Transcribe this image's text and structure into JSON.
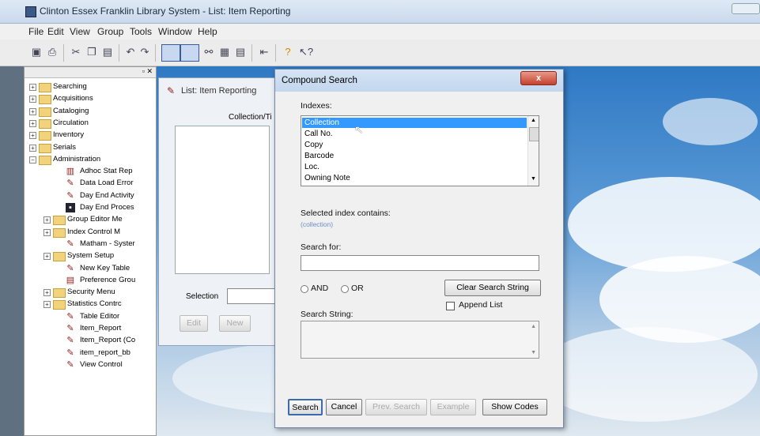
{
  "window": {
    "title": "Clinton Essex Franklin Library System - List: Item Reporting"
  },
  "menu": [
    "File",
    "Edit",
    "View",
    "Group",
    "Tools",
    "Window",
    "Help"
  ],
  "toolbar_icons": [
    "save-icon",
    "print-icon",
    "cut-icon",
    "copy-icon",
    "paste-icon",
    "undo-icon",
    "redo-icon",
    "window-icon",
    "split-window-icon",
    "link-icon",
    "grid-icon",
    "form-icon",
    "back-icon",
    "help-icon",
    "context-help-icon"
  ],
  "tree": {
    "items": [
      {
        "label": "Searching",
        "type": "folder",
        "expand": "+"
      },
      {
        "label": "Acquisitions",
        "type": "folder",
        "expand": "+"
      },
      {
        "label": "Cataloging",
        "type": "folder",
        "expand": "+"
      },
      {
        "label": "Circulation",
        "type": "folder",
        "expand": "+"
      },
      {
        "label": "Inventory",
        "type": "folder",
        "expand": "+"
      },
      {
        "label": "Serials",
        "type": "folder",
        "expand": "+"
      },
      {
        "label": "Administration",
        "type": "folder",
        "expand": "−"
      },
      {
        "label": "Adhoc Stat Rep",
        "type": "doc",
        "icon": "▥"
      },
      {
        "label": "Data Load Error",
        "type": "doc",
        "icon": "✎"
      },
      {
        "label": "Day End Activity",
        "type": "doc",
        "icon": "✎"
      },
      {
        "label": "Day End Proces",
        "type": "doc",
        "icon": "▪"
      },
      {
        "label": "Group Editor Me",
        "type": "folder",
        "expand": "+"
      },
      {
        "label": "Index Control M",
        "type": "folder",
        "expand": "+"
      },
      {
        "label": "Matham - Syster",
        "type": "doc",
        "icon": "✎"
      },
      {
        "label": "System Setup",
        "type": "folder",
        "expand": "+"
      },
      {
        "label": "New Key Table",
        "type": "doc",
        "icon": "✎"
      },
      {
        "label": "Preference Grou",
        "type": "doc",
        "icon": "▤"
      },
      {
        "label": "Security Menu",
        "type": "folder",
        "expand": "+"
      },
      {
        "label": "Statistics Contrc",
        "type": "folder",
        "expand": "+"
      },
      {
        "label": "Table Editor",
        "type": "doc",
        "icon": "✎"
      },
      {
        "label": "Item_Report",
        "type": "doc",
        "icon": "✎"
      },
      {
        "label": "Item_Report (Co",
        "type": "doc",
        "icon": "✎"
      },
      {
        "label": "item_report_bb",
        "type": "doc",
        "icon": "✎"
      },
      {
        "label": "View Control",
        "type": "doc",
        "icon": "✎"
      }
    ]
  },
  "list_window": {
    "title": "List: Item Reporting",
    "column_header": "Collection/Ti",
    "selection_label": "Selection",
    "edit_label": "Edit",
    "new_label": "New"
  },
  "dialog": {
    "title": "Compound Search",
    "close_label": "x",
    "indexes_label": "Indexes:",
    "indexes": [
      "Collection",
      "Call No.",
      "Copy",
      "Barcode",
      "Loc.",
      "Owning Note"
    ],
    "selected_index": 0,
    "selected_index_label": "Selected index contains:",
    "selected_index_value": "(collection)",
    "search_for_label": "Search for:",
    "search_for_value": "",
    "and_label": "AND",
    "or_label": "OR",
    "clear_label": "Clear Search String",
    "append_label": "Append List",
    "search_string_label": "Search String:",
    "search_string_value": "",
    "buttons": {
      "search": "Search",
      "cancel": "Cancel",
      "prev_search": "Prev. Search",
      "example": "Example",
      "show_codes": "Show Codes"
    }
  },
  "colors": {
    "selection": "#3399ff",
    "close": "#c4402c",
    "sky": "#5b9ad6"
  }
}
